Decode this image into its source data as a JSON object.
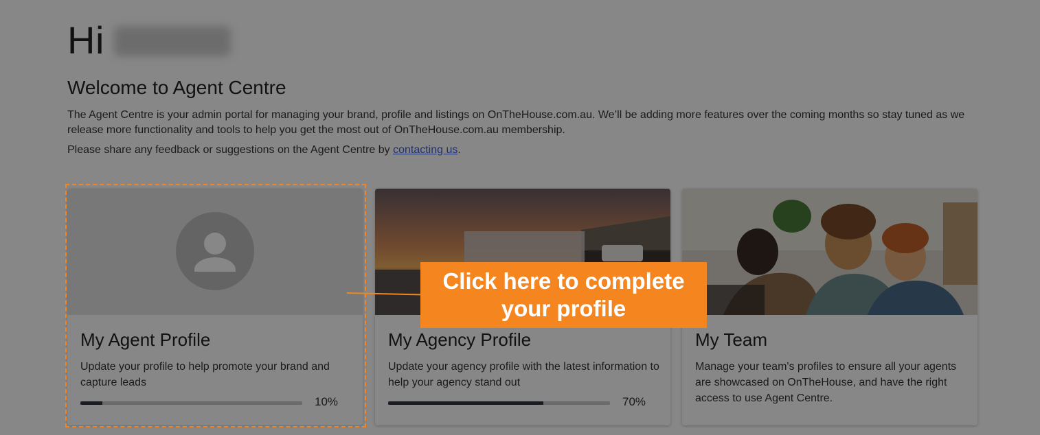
{
  "greeting": {
    "prefix": "Hi"
  },
  "welcome": {
    "title": "Welcome to Agent Centre",
    "intro": "The Agent Centre is your admin portal for managing your brand, profile and listings on OnTheHouse.com.au. We’ll be adding more features over the coming months so stay tuned as we release more functionality and tools to help you get the most out of OnTheHouse.com.au membership.",
    "feedback_prefix": "Please share any feedback or suggestions on the Agent Centre by ",
    "feedback_link": "contacting us",
    "feedback_suffix": "."
  },
  "cards": [
    {
      "title": "My Agent Profile",
      "description": "Update your profile to help promote your brand and capture leads",
      "progress_label": "10%",
      "progress": 0.1,
      "image": "avatar-placeholder-icon"
    },
    {
      "title": "My Agency Profile",
      "description": "Update your agency profile with the latest information to help your agency stand out",
      "progress_label": "70%",
      "progress": 0.7,
      "image": "agency-building-photo"
    },
    {
      "title": "My Team",
      "description": "Manage your team's profiles to ensure all your agents are showcased on OnTheHouse, and have the right access to use Agent Centre.",
      "image": "team-photo"
    }
  ],
  "callout": {
    "text": "Click here to complete your profile"
  },
  "colors": {
    "accent": "#f5861f",
    "link": "#3c5bd6",
    "progress_fill": "#2f3440",
    "progress_track": "#c9c9c9"
  }
}
